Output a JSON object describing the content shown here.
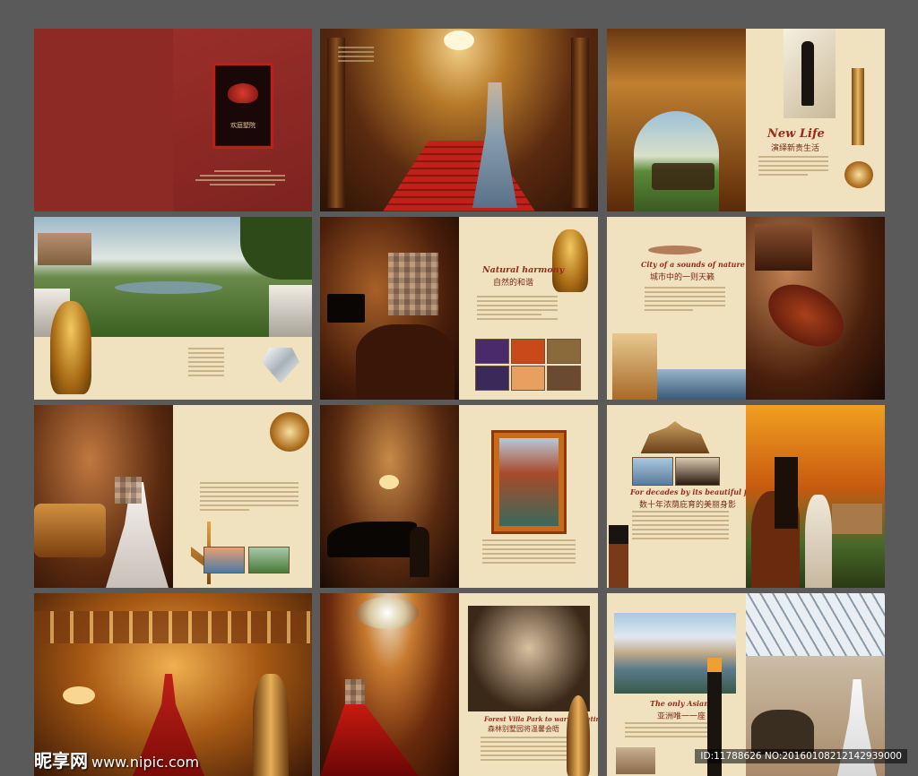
{
  "cover": {
    "emblem_text": "欢庭墅院"
  },
  "spread3": {
    "title_en": "New Life",
    "title_cn": "演绎新贵生活"
  },
  "spread5": {
    "title_en": "Natural harmony",
    "title_cn": "自然的和谐"
  },
  "spread6": {
    "title_en": "City of a sounds of nature",
    "title_cn": "城市中的一则天籁"
  },
  "spread9": {
    "title_en": "For decades by its beautiful figure",
    "title_cn": "数十年浓荫庇育的美丽身影"
  },
  "spread11": {
    "title_en": "Forest Villa Park to warm meeting",
    "title_cn": "森林别墅园将温馨会晤"
  },
  "spread12": {
    "title_en": "The only Asian a",
    "title_cn": "亚洲唯一一座"
  },
  "watermark": {
    "logo": "昵享网",
    "url": "www.nipic.com"
  },
  "image_id": "ID:11788626 NO:20160108212142939000",
  "colors": {
    "bg": "#5a5a5a",
    "cream": "#f0e2bf",
    "maroon": "#8e2a26",
    "accent": "#9a2a1a"
  }
}
